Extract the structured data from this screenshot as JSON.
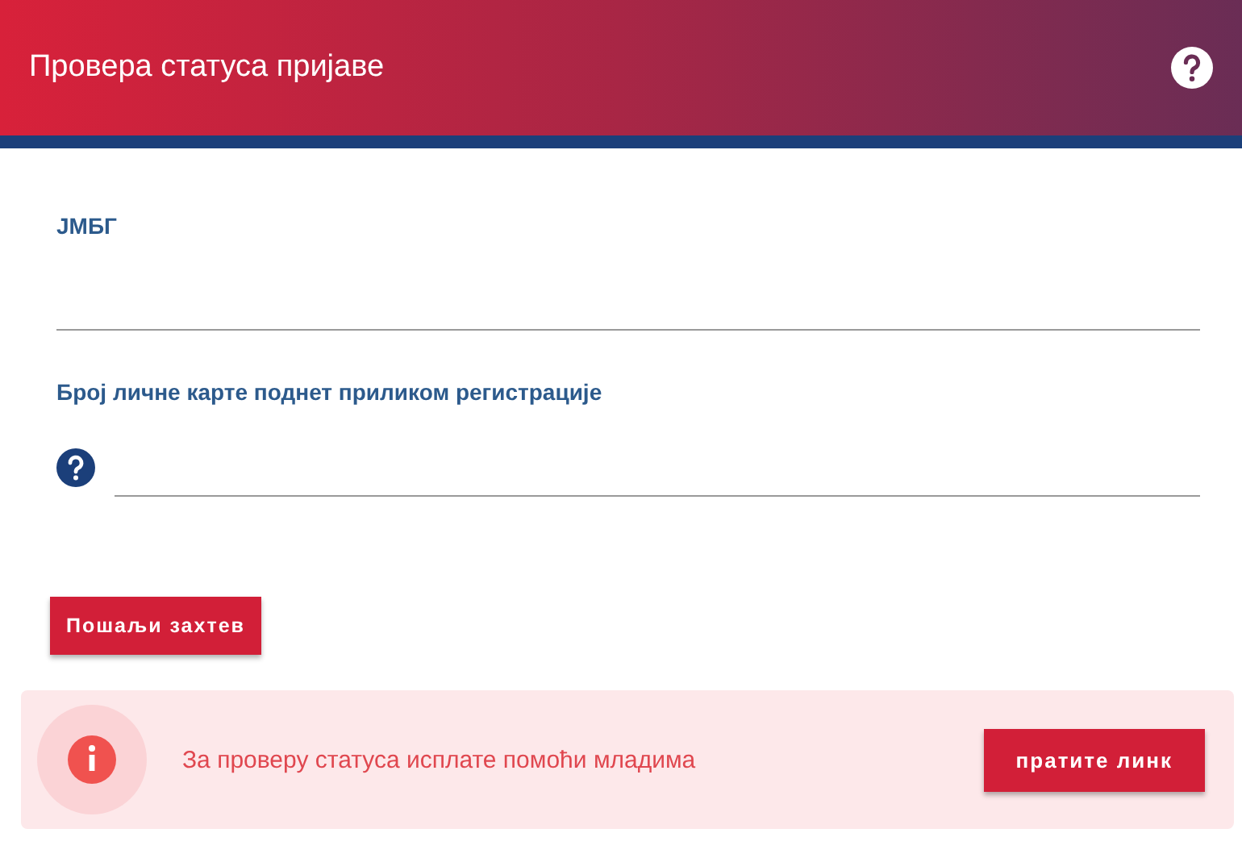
{
  "header": {
    "title": "Провера статуса пријаве"
  },
  "fields": [
    {
      "label": "ЈМБГ",
      "help": false
    },
    {
      "label": "Број личне карте поднет приликом регистрације",
      "help": true
    }
  ],
  "submit_button": "Пошаљи захтев",
  "notice": {
    "text": "За проверу статуса исплате помоћи младима",
    "button": "пратите линк"
  }
}
